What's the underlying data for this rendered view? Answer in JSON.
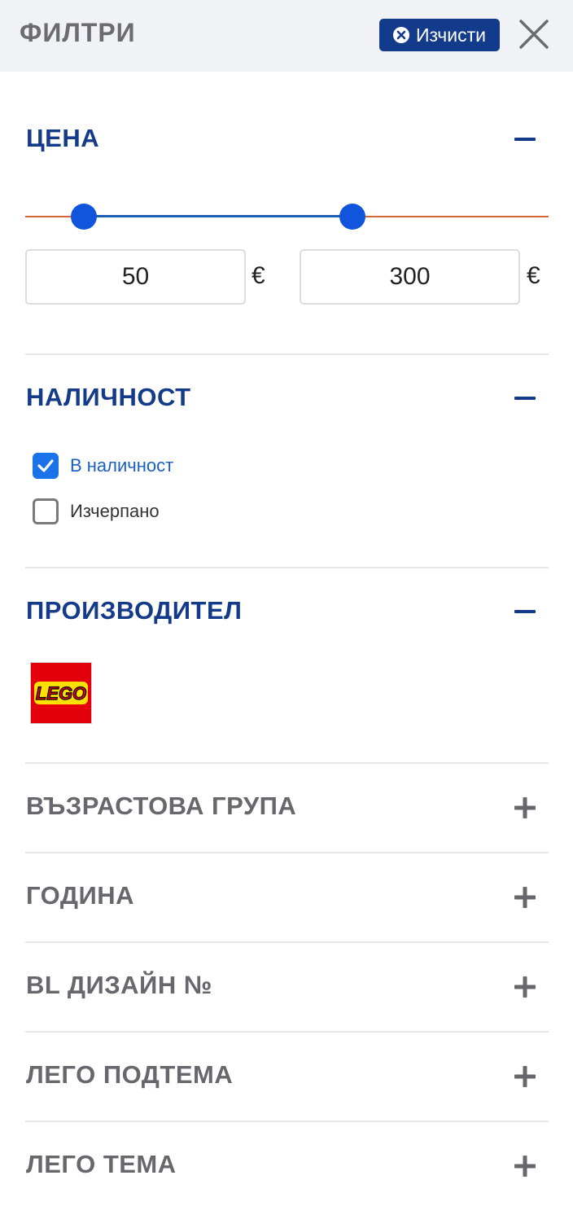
{
  "header": {
    "title": "ФИЛТРИ",
    "clear_label": "Изчисти"
  },
  "price": {
    "title": "ЦЕНА",
    "min_value": "50",
    "max_value": "300",
    "currency": "€"
  },
  "availability": {
    "title": "НАЛИЧНОСТ",
    "options": [
      {
        "label": "В наличност",
        "checked": true
      },
      {
        "label": "Изчерпано",
        "checked": false
      }
    ]
  },
  "manufacturer": {
    "title": "ПРОИЗВОДИТЕЛ",
    "brand": "LEGO"
  },
  "collapsed_sections": [
    {
      "title": "ВЪЗРАСТОВА ГРУПА"
    },
    {
      "title": "ГОДИНА"
    },
    {
      "title": "BL ДИЗАЙН №"
    },
    {
      "title": "ЛЕГО ПОДТЕМА"
    },
    {
      "title": "ЛЕГО ТЕМА"
    }
  ],
  "colors": {
    "accent": "#143a8a",
    "button": "#133b8c",
    "slider_active": "#1155dd",
    "slider_track": "#d8643a",
    "checkbox": "#1a73e8"
  }
}
